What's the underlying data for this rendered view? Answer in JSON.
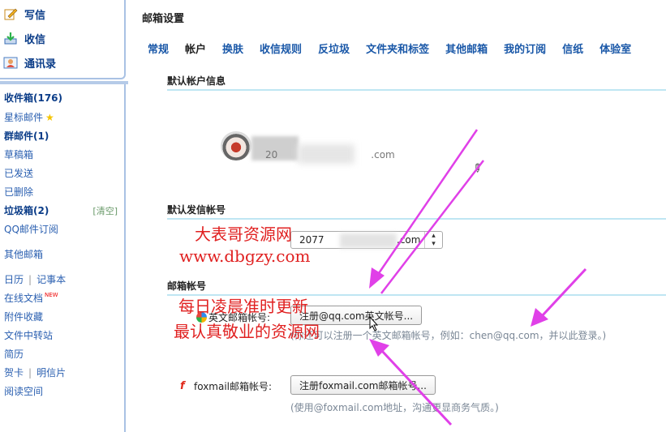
{
  "sidebar": {
    "actions": [
      {
        "label": "写信",
        "icon": "compose-icon"
      },
      {
        "label": "收信",
        "icon": "inbox-download-icon"
      },
      {
        "label": "通讯录",
        "icon": "contacts-icon"
      }
    ],
    "folders": {
      "inbox": "收件箱(176)",
      "starred": "星标邮件",
      "group": "群邮件(1)",
      "drafts": "草稿箱",
      "sent": "已发送",
      "deleted": "已删除",
      "spam": "垃圾箱(2)",
      "spam_clear": "[清空]",
      "qq_subscription": "QQ邮件订阅",
      "other_mailboxes": "其他邮箱",
      "calendar": "日历",
      "notes": "记事本",
      "online_docs": "在线文档",
      "new_badge": "NEW",
      "attachments": "附件收藏",
      "file_transfer": "文件中转站",
      "resume": "简历",
      "greeting_cards": "贺卡",
      "postcards": "明信片",
      "reading_space": "阅读空间"
    }
  },
  "main": {
    "title": "邮箱设置",
    "tabs": [
      "常规",
      "帐户",
      "换肤",
      "收信规则",
      "反垃圾",
      "文件夹和标签",
      "其他邮箱",
      "我的订阅",
      "信纸",
      "体验室"
    ],
    "active_tab": "帐户",
    "default_account": {
      "section_title": "默认帐户信息",
      "email_visible": "20",
      "email_suffix": ".com"
    },
    "default_sender": {
      "section_title": "默认发信帐号",
      "selected_prefix": "2077",
      "selected_suffix": ".com"
    },
    "mailbox_accounts": {
      "section_title": "邮箱帐号",
      "english_label": "英文邮箱帐号:",
      "english_button": "注册@qq.com英文帐号...",
      "english_hint": "(你还可以注册一个英文邮箱帐号，例如：chen@qq.com，并以此登录。)",
      "foxmail_label": "foxmail邮箱帐号:",
      "foxmail_button": "注册foxmail.com邮箱帐号...",
      "foxmail_hint": "(使用@foxmail.com地址，沟通更显商务气质。)"
    }
  },
  "watermark": {
    "line1": "大表哥资源网",
    "line2": "www.dbgzy.com",
    "line3": "每日凌晨准时更新",
    "line4": "最认真敬业的资源网"
  },
  "colors": {
    "link": "#2a5fb0",
    "tab": "#1a58a8",
    "section_rule": "#bfe6f3",
    "watermark": "#e02020",
    "arrows": "#e040e8"
  }
}
